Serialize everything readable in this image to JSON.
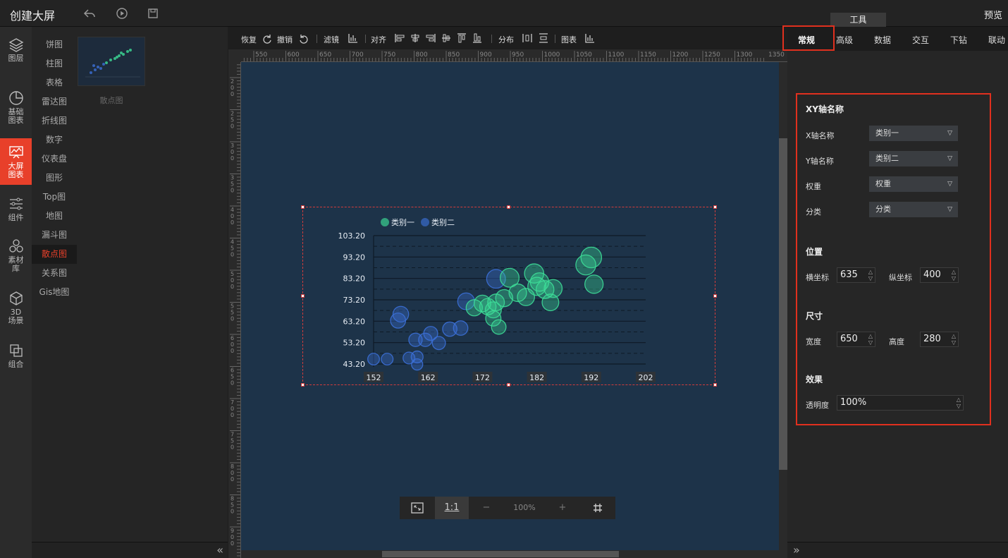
{
  "app": {
    "title": "创建大屏",
    "preview": "预览",
    "tool_tab": "工具"
  },
  "leftnav": [
    {
      "label": "图层",
      "icon": "layers-icon"
    },
    {
      "label": "基础图表",
      "icon": "pie-icon"
    },
    {
      "label": "大屏图表",
      "icon": "screen-chart-icon",
      "active": true
    },
    {
      "label": "组件",
      "icon": "sliders-icon"
    },
    {
      "label": "素材库",
      "icon": "hexagons-icon"
    },
    {
      "label": "3D场景",
      "icon": "cube-icon"
    },
    {
      "label": "组合",
      "icon": "group-icon"
    }
  ],
  "categories": [
    "饼图",
    "柱图",
    "表格",
    "雷达图",
    "折线图",
    "数字",
    "仪表盘",
    "图形",
    "Top图",
    "地图",
    "漏斗图",
    "散点图",
    "关系图",
    "Gis地图"
  ],
  "active_category": "散点图",
  "thumbnail_label": "散点图",
  "toolbar": {
    "redo": "恢复",
    "undo": "撤销",
    "filter": "滤镜",
    "align": "对齐",
    "distribute": "分布",
    "chart": "图表"
  },
  "ruler_ticks": [
    "550",
    "600",
    "650",
    "700",
    "750",
    "800",
    "850",
    "900",
    "950",
    "1000",
    "1050",
    "1100",
    "1150",
    "1200",
    "1250",
    "1300",
    "1350"
  ],
  "ruler_v_ticks": [
    "200",
    "250",
    "300",
    "350",
    "400",
    "450",
    "500",
    "550",
    "600",
    "650",
    "700",
    "750",
    "800",
    "850",
    "900"
  ],
  "zoom": {
    "ratio": "1:1",
    "minus": "−",
    "level": "100%",
    "plus": "+"
  },
  "right_tabs": [
    "常规",
    "高级",
    "数据",
    "交互",
    "下钻",
    "联动"
  ],
  "props": {
    "xy_title": "XY轴名称",
    "x_name_label": "X轴名称",
    "x_name_value": "类别一",
    "y_name_label": "Y轴名称",
    "y_name_value": "类别二",
    "weight_label": "权重",
    "weight_value": "权重",
    "category_label": "分类",
    "category_value": "分类",
    "position_title": "位置",
    "x_pos_label": "横坐标",
    "x_pos_value": "635",
    "y_pos_label": "纵坐标",
    "y_pos_value": "400",
    "size_title": "尺寸",
    "width_label": "宽度",
    "width_value": "650",
    "height_label": "高度",
    "height_value": "280",
    "effect_title": "效果",
    "opacity_label": "透明度",
    "opacity_value": "100%"
  },
  "colors": {
    "accent": "#e8402a",
    "series1": "#3ddc97",
    "series2": "#3b6fd6",
    "canvas": "#1d3349"
  },
  "chart_data": {
    "type": "scatter",
    "legend": [
      "类别一",
      "类别二"
    ],
    "x_ticks": [
      "152",
      "162",
      "172",
      "182",
      "192",
      "202"
    ],
    "y_ticks": [
      "103.20",
      "93.20",
      "83.20",
      "73.20",
      "63.20",
      "53.20",
      "43.20"
    ],
    "xlim": [
      152,
      202
    ],
    "ylim": [
      43.2,
      103.2
    ],
    "series": [
      {
        "name": "类别二",
        "points": [
          [
            152,
            45.5
          ],
          [
            154.5,
            45.5
          ],
          [
            156.5,
            63.5
          ],
          [
            157,
            66.5
          ],
          [
            158.5,
            46
          ],
          [
            160,
            46.5
          ],
          [
            160,
            43
          ],
          [
            159.7,
            54.5
          ],
          [
            161.5,
            54.5
          ],
          [
            162.5,
            57.5
          ],
          [
            164,
            53
          ],
          [
            166,
            59.5
          ],
          [
            168,
            60
          ],
          [
            169,
            72.5
          ],
          [
            174.5,
            83
          ]
        ]
      },
      {
        "name": "类别一",
        "points": [
          [
            170.5,
            69.5
          ],
          [
            172,
            71.5
          ],
          [
            173,
            70
          ],
          [
            174,
            68.5
          ],
          [
            174,
            64.5
          ],
          [
            174.5,
            72
          ],
          [
            175,
            60.5
          ],
          [
            176,
            74
          ],
          [
            177,
            83.5
          ],
          [
            178.5,
            76.5
          ],
          [
            180,
            74.5
          ],
          [
            181.5,
            85.5
          ],
          [
            182,
            79.5
          ],
          [
            182.5,
            81.5
          ],
          [
            183.5,
            78
          ],
          [
            184.5,
            72
          ],
          [
            185,
            78.5
          ],
          [
            191,
            89.5
          ],
          [
            192,
            93
          ],
          [
            192.5,
            80.5
          ]
        ]
      }
    ]
  }
}
